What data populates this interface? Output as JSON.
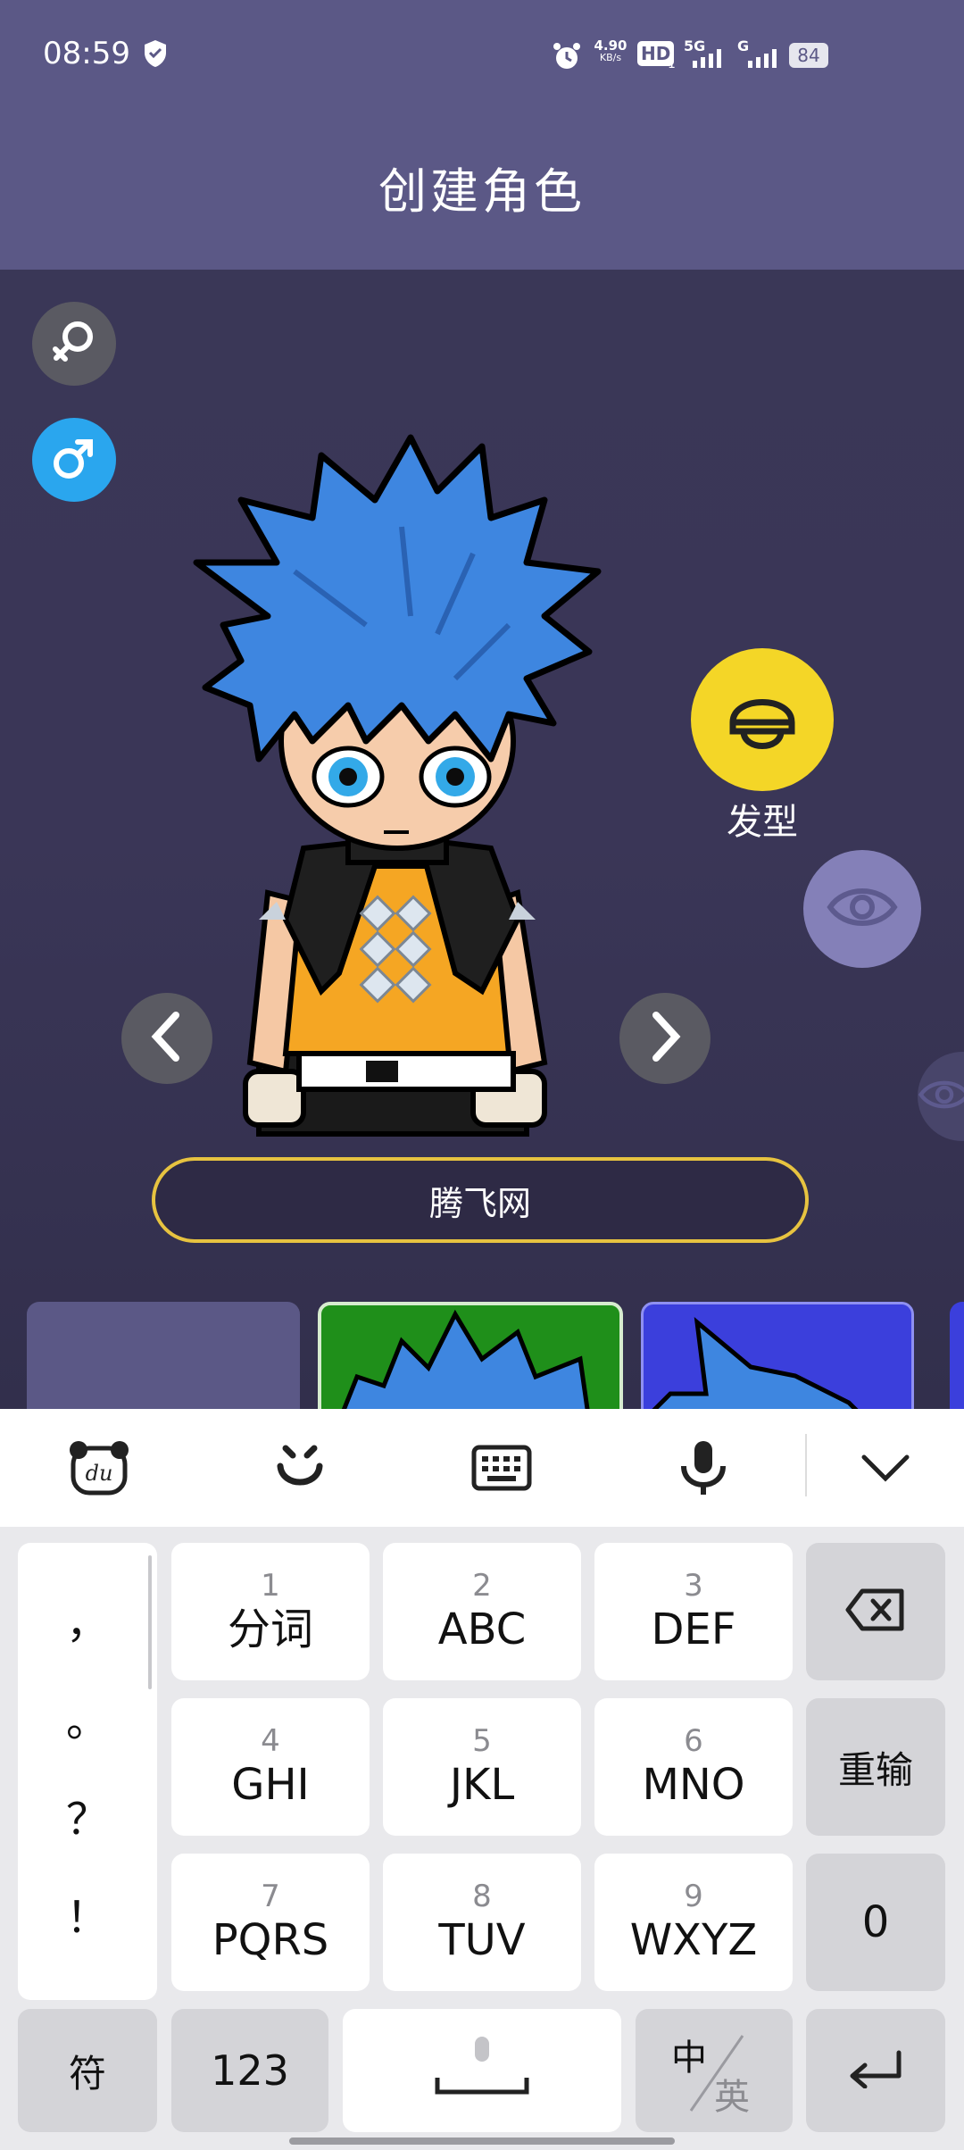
{
  "status_bar": {
    "time": "08:59",
    "net_speed_value": "4.90",
    "net_speed_unit": "KB/s",
    "hd_label": "HD",
    "hd_sub": "1",
    "signal1_label": "5G",
    "signal2_label": "G",
    "battery": "84"
  },
  "header": {
    "title": "创建角色"
  },
  "gender": {
    "female_icon": "female-symbol-icon",
    "male_icon": "male-symbol-icon"
  },
  "side_buttons": {
    "hairstyle_label": "发型"
  },
  "name_input": {
    "value": "腾飞网"
  },
  "keyboard": {
    "toolbar": [
      "du-logo-icon",
      "emoji-icon",
      "keyboard-icon",
      "microphone-icon",
      "chevron-down-icon"
    ],
    "punctuation": [
      "，",
      "。",
      "？",
      "！"
    ],
    "keys": [
      {
        "num": "1",
        "label": "分词"
      },
      {
        "num": "2",
        "label": "ABC"
      },
      {
        "num": "3",
        "label": "DEF"
      },
      {
        "num": "4",
        "label": "GHI"
      },
      {
        "num": "5",
        "label": "JKL"
      },
      {
        "num": "6",
        "label": "MNO"
      },
      {
        "num": "7",
        "label": "PQRS"
      },
      {
        "num": "8",
        "label": "TUV"
      },
      {
        "num": "9",
        "label": "WXYZ"
      }
    ],
    "reenter": "重输",
    "zero": "0",
    "symbols": "符",
    "numbers": "123",
    "lang_top": "中",
    "lang_bottom": "英"
  },
  "colors": {
    "header_bg": "#5b5886",
    "stage_bg": "#34304f",
    "male_button": "#2aa6ee",
    "hair_button": "#f4d627",
    "input_border": "#e7c340",
    "hair_blue": "#3e86e0"
  }
}
